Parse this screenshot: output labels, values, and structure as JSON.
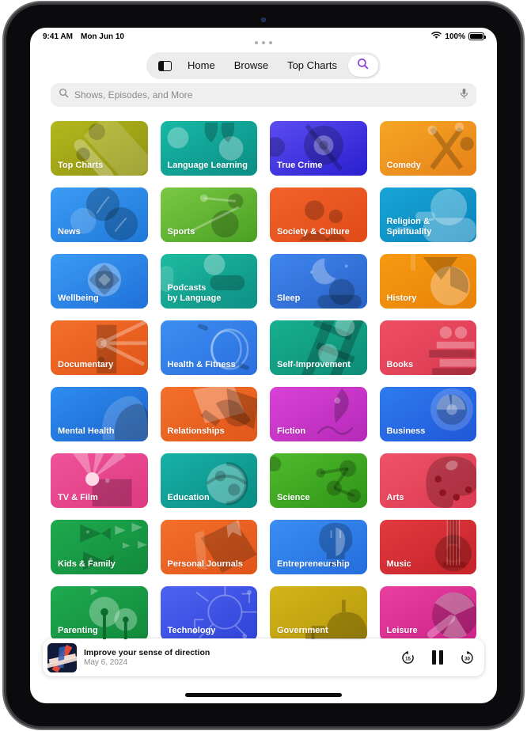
{
  "status_bar": {
    "time": "9:41 AM",
    "date": "Mon Jun 10",
    "battery_percent": "100%",
    "wifi_icon": "wifi-icon",
    "battery_icon": "battery-full-icon"
  },
  "nav": {
    "sidebar_toggle_icon": "sidebar-toggle-icon",
    "tabs": [
      {
        "label": "Home",
        "selected": false
      },
      {
        "label": "Browse",
        "selected": false
      },
      {
        "label": "Top Charts",
        "selected": false
      }
    ],
    "search_button_icon": "search-icon",
    "search_button_color": "#8b44d8"
  },
  "search": {
    "placeholder": "Shows, Episodes, and More",
    "value": "",
    "leading_icon": "search-icon",
    "trailing_icon": "microphone-icon"
  },
  "categories": [
    {
      "label": "Top Charts",
      "art": "chart-bars",
      "c1": "#b4b81c",
      "c2": "#8e9211"
    },
    {
      "label": "Language Learning",
      "art": "quotes",
      "c1": "#17b8a6",
      "c2": "#0b8d85"
    },
    {
      "label": "True Crime",
      "art": "magnifier-eye",
      "c1": "#5b4df0",
      "c2": "#2a1fd0"
    },
    {
      "label": "Comedy",
      "art": "confetti",
      "c1": "#f5a623",
      "c2": "#e8821a"
    },
    {
      "label": "News",
      "art": "clocks",
      "c1": "#3b9cf5",
      "c2": "#1f78d8"
    },
    {
      "label": "Sports",
      "art": "molecule-ball",
      "c1": "#7ac943",
      "c2": "#4aa023"
    },
    {
      "label": "Society & Culture",
      "art": "people",
      "c1": "#f2622a",
      "c2": "#e04b18"
    },
    {
      "label": "Religion & Spirituality",
      "art": "clouds",
      "c1": "#17a6d6",
      "c2": "#0a83bb"
    },
    {
      "label": "Wellbeing",
      "art": "flower",
      "c1": "#3b9cf5",
      "c2": "#1f6fd8"
    },
    {
      "label": "Podcasts\nby Language",
      "art": "speech-bubbles",
      "c1": "#1dbba0",
      "c2": "#0d8f85"
    },
    {
      "label": "Sleep",
      "art": "moon-cloud",
      "c1": "#3f86ee",
      "c2": "#2a63c8"
    },
    {
      "label": "History",
      "art": "pie-slice",
      "c1": "#f79a10",
      "c2": "#e8820a"
    },
    {
      "label": "Documentary",
      "art": "projector",
      "c1": "#f4702a",
      "c2": "#e05418"
    },
    {
      "label": "Health & Fitness",
      "art": "jump-rope",
      "c1": "#3d8ef2",
      "c2": "#2a6fdd"
    },
    {
      "label": "Self-Improvement",
      "art": "ladder",
      "c1": "#16b08e",
      "c2": "#0e8c78"
    },
    {
      "label": "Books",
      "art": "book-stack",
      "c1": "#ef4f63",
      "c2": "#d93a51"
    },
    {
      "label": "Mental Health",
      "art": "head-profile",
      "c1": "#2f8ef0",
      "c2": "#1a63cc"
    },
    {
      "label": "Relationships",
      "art": "handshake",
      "c1": "#f4702a",
      "c2": "#e0571a"
    },
    {
      "label": "Fiction",
      "art": "quill-pen",
      "c1": "#d942d6",
      "c2": "#b52ab8"
    },
    {
      "label": "Business",
      "art": "donut-chart",
      "c1": "#2f7bf0",
      "c2": "#1f57d8"
    },
    {
      "label": "TV & Film",
      "art": "spotlight",
      "c1": "#f0529a",
      "c2": "#dd3a80"
    },
    {
      "label": "Education",
      "art": "globe",
      "c1": "#17b2a6",
      "c2": "#0a8b85"
    },
    {
      "label": "Science",
      "art": "molecule",
      "c1": "#4fbb2c",
      "c2": "#2f9418"
    },
    {
      "label": "Arts",
      "art": "palette",
      "c1": "#ef5268",
      "c2": "#dc3b52"
    },
    {
      "label": "Kids & Family",
      "art": "fish",
      "c1": "#1faa4e",
      "c2": "#118a3c"
    },
    {
      "label": "Personal Journals",
      "art": "journal",
      "c1": "#f4702a",
      "c2": "#e0541a"
    },
    {
      "label": "Entrepreneurship",
      "art": "lightbulb",
      "c1": "#3b8ef2",
      "c2": "#246ddd"
    },
    {
      "label": "Music",
      "art": "guitar",
      "c1": "#e23a3f",
      "c2": "#c42329"
    },
    {
      "label": "Parenting",
      "art": "trees",
      "c1": "#1faa4e",
      "c2": "#118a3c"
    },
    {
      "label": "Technology",
      "art": "circuit",
      "c1": "#4d63f0",
      "c2": "#2f43d8"
    },
    {
      "label": "Government",
      "art": "capitol",
      "c1": "#d3b41a",
      "c2": "#b8990c"
    },
    {
      "label": "Leisure",
      "art": "umbrella",
      "c1": "#ea3fa0",
      "c2": "#cc2388"
    }
  ],
  "player": {
    "artwork_name": "episode-artwork",
    "title": "Improve your sense of direction",
    "date": "May 6, 2024",
    "skip_back_label": "15",
    "skip_forward_label": "30",
    "skip_back_icon": "skip-back-15-icon",
    "play_pause_icon": "pause-icon",
    "skip_forward_icon": "skip-forward-30-icon",
    "is_playing": true
  },
  "home_indicator": "home-indicator"
}
